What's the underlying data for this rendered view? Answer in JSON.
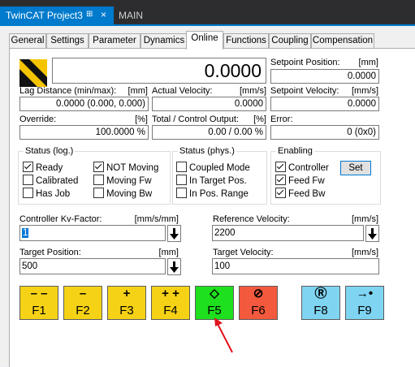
{
  "doc_tabs": {
    "active_title": "TwinCAT Project3",
    "pin_icon": "⊞",
    "close_icon": "×",
    "inactive_title": "MAIN"
  },
  "tabs": [
    "General",
    "Settings",
    "Parameter",
    "Dynamics",
    "Online",
    "Functions",
    "Coupling",
    "Compensation"
  ],
  "online": {
    "position_value": "0.0000",
    "setpoint_position": {
      "label": "Setpoint Position:",
      "unit": "[mm]",
      "value": "0.0000"
    },
    "lag_distance": {
      "label": "Lag Distance (min/max):",
      "unit": "[mm]",
      "value": "0.0000  (0.000, 0.000)"
    },
    "actual_velocity": {
      "label": "Actual Velocity:",
      "unit": "[mm/s]",
      "value": "0.0000"
    },
    "setpoint_velocity": {
      "label": "Setpoint Velocity:",
      "unit": "[mm/s]",
      "value": "0.0000"
    },
    "override": {
      "label": "Override:",
      "unit": "[%]",
      "value": "100.0000 %"
    },
    "total_output": {
      "label": "Total / Control Output:",
      "unit": "[%]",
      "value": "0.00 /  0.00 %"
    },
    "error": {
      "label": "Error:",
      "value": "0 (0x0)"
    },
    "status_log": {
      "title": "Status (log.)",
      "items": [
        {
          "label": "Ready",
          "checked": true
        },
        {
          "label": "NOT Moving",
          "checked": true
        },
        {
          "label": "Calibrated",
          "checked": false
        },
        {
          "label": "Moving Fw",
          "checked": false
        },
        {
          "label": "Has Job",
          "checked": false
        },
        {
          "label": "Moving Bw",
          "checked": false
        }
      ]
    },
    "status_phys": {
      "title": "Status (phys.)",
      "items": [
        {
          "label": "Coupled Mode",
          "checked": false
        },
        {
          "label": "In Target Pos.",
          "checked": false
        },
        {
          "label": "In Pos. Range",
          "checked": false
        }
      ]
    },
    "enabling": {
      "title": "Enabling",
      "items": [
        {
          "label": "Controller",
          "checked": true
        },
        {
          "label": "Feed Fw",
          "checked": true
        },
        {
          "label": "Feed Bw",
          "checked": true
        }
      ],
      "set_label": "Set"
    },
    "kv_factor": {
      "label": "Controller Kv-Factor:",
      "unit": "[mm/s/mm]",
      "value": "1"
    },
    "reference_velocity": {
      "label": "Reference Velocity:",
      "unit": "[mm/s]",
      "value": "2200"
    },
    "target_position": {
      "label": "Target Position:",
      "unit": "[mm]",
      "value": "500"
    },
    "target_velocity": {
      "label": "Target Velocity:",
      "unit": "[mm/s]",
      "value": "100"
    },
    "fkeys": [
      {
        "name": "F1",
        "glyph": "– –",
        "color": "#f5d215"
      },
      {
        "name": "F2",
        "glyph": "–",
        "color": "#f5d215"
      },
      {
        "name": "F3",
        "glyph": "+",
        "color": "#f5d215"
      },
      {
        "name": "F4",
        "glyph": "+ +",
        "color": "#f5d215"
      },
      {
        "name": "F5",
        "glyph": "◇",
        "color": "#1ee01e"
      },
      {
        "name": "F6",
        "glyph": "⊘",
        "color": "#f3593c"
      },
      {
        "name": "F8",
        "glyph": "Ⓡ",
        "color": "#7fd4f2"
      },
      {
        "name": "F9",
        "glyph": "→•",
        "color": "#7fd4f2"
      }
    ]
  },
  "colors": {
    "accent": "#007acc",
    "annotation_arrow": "#e0141e"
  }
}
